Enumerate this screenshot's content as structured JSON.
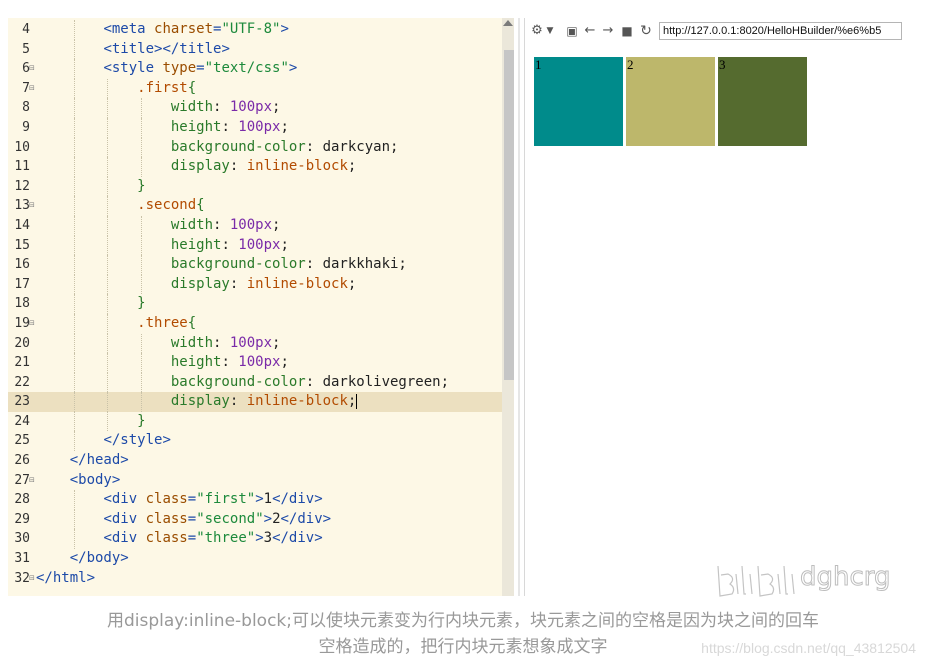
{
  "editor": {
    "lines": [
      {
        "no": "4",
        "fold": false,
        "indent": 2,
        "tokens": [
          [
            "tag",
            "<meta "
          ],
          [
            "attr",
            "charset"
          ],
          [
            "tag",
            "="
          ],
          [
            "str",
            "\"UTF-8\""
          ],
          [
            "tag",
            ">"
          ]
        ]
      },
      {
        "no": "5",
        "fold": false,
        "indent": 2,
        "tokens": [
          [
            "tag",
            "<title></title>"
          ]
        ]
      },
      {
        "no": "6",
        "fold": true,
        "indent": 2,
        "tokens": [
          [
            "tag",
            "<style "
          ],
          [
            "attr",
            "type"
          ],
          [
            "tag",
            "="
          ],
          [
            "str",
            "\"text/css\""
          ],
          [
            "tag",
            ">"
          ]
        ]
      },
      {
        "no": "7",
        "fold": true,
        "indent": 3,
        "tokens": [
          [
            "sel",
            ".first"
          ],
          [
            "brace",
            "{"
          ]
        ]
      },
      {
        "no": "8",
        "fold": false,
        "indent": 4,
        "tokens": [
          [
            "prop",
            "width"
          ],
          [
            "txt",
            ": "
          ],
          [
            "num",
            "100"
          ],
          [
            "unit",
            "px"
          ],
          [
            "txt",
            ";"
          ]
        ]
      },
      {
        "no": "9",
        "fold": false,
        "indent": 4,
        "tokens": [
          [
            "prop",
            "height"
          ],
          [
            "txt",
            ": "
          ],
          [
            "num",
            "100"
          ],
          [
            "unit",
            "px"
          ],
          [
            "txt",
            ";"
          ]
        ]
      },
      {
        "no": "10",
        "fold": false,
        "indent": 4,
        "tokens": [
          [
            "prop",
            "background-color"
          ],
          [
            "txt",
            ": darkcyan;"
          ]
        ]
      },
      {
        "no": "11",
        "fold": false,
        "indent": 4,
        "tokens": [
          [
            "prop",
            "display"
          ],
          [
            "txt",
            ": "
          ],
          [
            "kw",
            "inline-block"
          ],
          [
            "txt",
            ";"
          ]
        ]
      },
      {
        "no": "12",
        "fold": false,
        "indent": 3,
        "tokens": [
          [
            "brace",
            "}"
          ]
        ]
      },
      {
        "no": "13",
        "fold": true,
        "indent": 3,
        "tokens": [
          [
            "sel",
            ".second"
          ],
          [
            "brace",
            "{"
          ]
        ]
      },
      {
        "no": "14",
        "fold": false,
        "indent": 4,
        "tokens": [
          [
            "prop",
            "width"
          ],
          [
            "txt",
            ": "
          ],
          [
            "num",
            "100"
          ],
          [
            "unit",
            "px"
          ],
          [
            "txt",
            ";"
          ]
        ]
      },
      {
        "no": "15",
        "fold": false,
        "indent": 4,
        "tokens": [
          [
            "prop",
            "height"
          ],
          [
            "txt",
            ": "
          ],
          [
            "num",
            "100"
          ],
          [
            "unit",
            "px"
          ],
          [
            "txt",
            ";"
          ]
        ]
      },
      {
        "no": "16",
        "fold": false,
        "indent": 4,
        "tokens": [
          [
            "prop",
            "background-color"
          ],
          [
            "txt",
            ": darkkhaki;"
          ]
        ]
      },
      {
        "no": "17",
        "fold": false,
        "indent": 4,
        "tokens": [
          [
            "prop",
            "display"
          ],
          [
            "txt",
            ": "
          ],
          [
            "kw",
            "inline-block"
          ],
          [
            "txt",
            ";"
          ]
        ]
      },
      {
        "no": "18",
        "fold": false,
        "indent": 3,
        "tokens": [
          [
            "brace",
            "}"
          ]
        ]
      },
      {
        "no": "19",
        "fold": true,
        "indent": 3,
        "tokens": [
          [
            "sel",
            ".three"
          ],
          [
            "brace",
            "{"
          ]
        ]
      },
      {
        "no": "20",
        "fold": false,
        "indent": 4,
        "tokens": [
          [
            "prop",
            "width"
          ],
          [
            "txt",
            ": "
          ],
          [
            "num",
            "100"
          ],
          [
            "unit",
            "px"
          ],
          [
            "txt",
            ";"
          ]
        ]
      },
      {
        "no": "21",
        "fold": false,
        "indent": 4,
        "tokens": [
          [
            "prop",
            "height"
          ],
          [
            "txt",
            ": "
          ],
          [
            "num",
            "100"
          ],
          [
            "unit",
            "px"
          ],
          [
            "txt",
            ";"
          ]
        ]
      },
      {
        "no": "22",
        "fold": false,
        "indent": 4,
        "tokens": [
          [
            "prop",
            "background-color"
          ],
          [
            "txt",
            ": darkolivegreen;"
          ]
        ]
      },
      {
        "no": "23",
        "fold": false,
        "indent": 4,
        "current": true,
        "tokens": [
          [
            "prop",
            "display"
          ],
          [
            "txt",
            ": "
          ],
          [
            "kw",
            "inline-block"
          ],
          [
            "txt",
            ";"
          ]
        ]
      },
      {
        "no": "24",
        "fold": false,
        "indent": 3,
        "tokens": [
          [
            "brace",
            "}"
          ]
        ]
      },
      {
        "no": "25",
        "fold": false,
        "indent": 2,
        "tokens": [
          [
            "tag",
            "</style>"
          ]
        ]
      },
      {
        "no": "26",
        "fold": false,
        "indent": 1,
        "tokens": [
          [
            "tag",
            "</head>"
          ]
        ]
      },
      {
        "no": "27",
        "fold": true,
        "indent": 1,
        "tokens": [
          [
            "tag",
            "<body>"
          ]
        ]
      },
      {
        "no": "28",
        "fold": false,
        "indent": 2,
        "tokens": [
          [
            "tag",
            "<div "
          ],
          [
            "attr",
            "class"
          ],
          [
            "tag",
            "="
          ],
          [
            "str",
            "\"first\""
          ],
          [
            "tag",
            ">"
          ],
          [
            "txt",
            "1"
          ],
          [
            "tag",
            "</div>"
          ]
        ]
      },
      {
        "no": "29",
        "fold": false,
        "indent": 2,
        "tokens": [
          [
            "tag",
            "<div "
          ],
          [
            "attr",
            "class"
          ],
          [
            "tag",
            "="
          ],
          [
            "str",
            "\"second\""
          ],
          [
            "tag",
            ">"
          ],
          [
            "txt",
            "2"
          ],
          [
            "tag",
            "</div>"
          ]
        ]
      },
      {
        "no": "30",
        "fold": false,
        "indent": 2,
        "tokens": [
          [
            "tag",
            "<div "
          ],
          [
            "attr",
            "class"
          ],
          [
            "tag",
            "="
          ],
          [
            "str",
            "\"three\""
          ],
          [
            "tag",
            ">"
          ],
          [
            "txt",
            "3"
          ],
          [
            "tag",
            "</div>"
          ]
        ]
      },
      {
        "no": "31",
        "fold": false,
        "indent": 1,
        "tokens": [
          [
            "tag",
            "</body>"
          ]
        ]
      },
      {
        "no": "32",
        "fold": true,
        "indent": 0,
        "tokens": [
          [
            "tag",
            "</html>"
          ]
        ]
      }
    ]
  },
  "browser": {
    "url": "http://127.0.0.1:8020/HelloHBuilder/%e6%b5",
    "icons": [
      "settings-icon",
      "dropdown-icon",
      "console-icon",
      "back-icon",
      "forward-icon",
      "stop-icon",
      "reload-icon"
    ],
    "boxes": [
      {
        "label": "1",
        "color": "#008b8b"
      },
      {
        "label": "2",
        "color": "#bdb76b"
      },
      {
        "label": "3",
        "color": "#556b2f"
      }
    ]
  },
  "watermark": {
    "text": "dghcrg"
  },
  "caption": {
    "line1": "用display:inline-block;可以使块元素变为行内块元素，块元素之间的空格是因为块之间的回车",
    "line2": "空格造成的，把行内块元素想象成文字"
  },
  "source_url": "https://blog.csdn.net/qq_43812504"
}
